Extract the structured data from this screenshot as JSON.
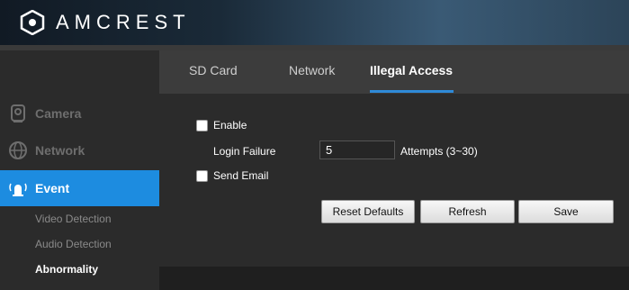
{
  "brand": {
    "name": "AMCREST"
  },
  "sidebar": {
    "items": [
      {
        "label": "Camera",
        "icon": "camera-icon"
      },
      {
        "label": "Network",
        "icon": "globe-icon"
      },
      {
        "label": "Event",
        "icon": "alarm-icon",
        "active": true
      }
    ],
    "subitems": [
      {
        "label": "Video Detection"
      },
      {
        "label": "Audio Detection"
      },
      {
        "label": "Abnormality",
        "current": true
      }
    ]
  },
  "tabs": [
    {
      "label": "SD Card"
    },
    {
      "label": "Network"
    },
    {
      "label": "Illegal Access",
      "active": true
    }
  ],
  "form": {
    "enable_label": "Enable",
    "enable_checked": false,
    "login_failure_label": "Login Failure",
    "login_failure_value": "5",
    "attempts_label": "Attempts (3~30)",
    "send_email_label": "Send Email",
    "send_email_checked": false
  },
  "buttons": {
    "reset": "Reset Defaults",
    "refresh": "Refresh",
    "save": "Save"
  },
  "colors": {
    "accent": "#2e8ad8",
    "active_item": "#1d8ce0",
    "background": "#2b2b2b",
    "tabbar": "#3c3c3c"
  }
}
